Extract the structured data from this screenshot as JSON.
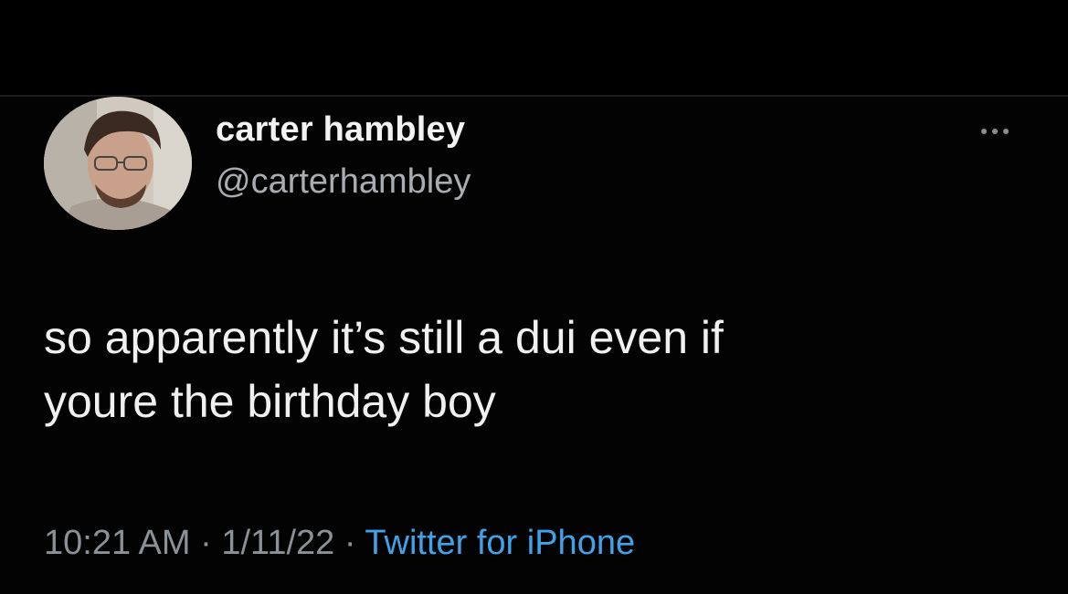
{
  "colors": {
    "background": "#000000",
    "text_primary": "#f0f0f0",
    "text_secondary": "#8b9196",
    "link": "#3fa3ea"
  },
  "tweet": {
    "author": {
      "display_name": "carter hambley",
      "handle": "@carterhambley",
      "avatar_icon": "profile-photo"
    },
    "more_icon": "more-options-icon",
    "text": "so apparently it’s still a dui even if\nyoure the birthday boy",
    "meta": {
      "time": "10:21 AM",
      "separator": " · ",
      "date": "1/11/22",
      "source": "Twitter for iPhone"
    }
  }
}
